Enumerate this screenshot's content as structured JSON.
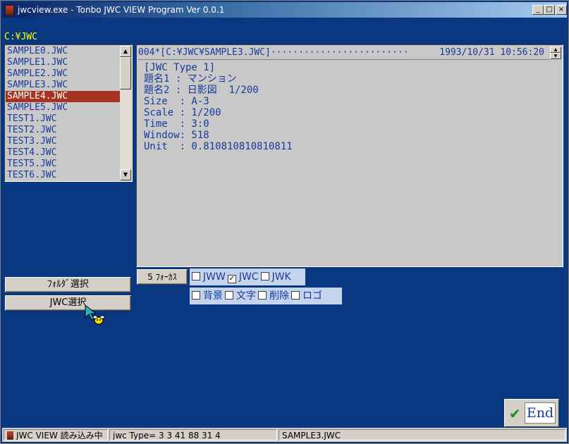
{
  "window": {
    "title": "jwcview.exe - Tonbo JWC VIEW Program Ver 0.0.1",
    "minimize": "_",
    "maximize": "□",
    "close": "×"
  },
  "path": "C:¥JWC",
  "file_list": {
    "items": [
      "SAMPLE0.JWC",
      "SAMPLE1.JWC",
      "SAMPLE2.JWC",
      "SAMPLE3.JWC",
      "SAMPLE4.JWC",
      "SAMPLE5.JWC",
      "TEST1.JWC",
      "TEST2.JWC",
      "TEST3.JWC",
      "TEST4.JWC",
      "TEST5.JWC",
      "TEST6.JWC"
    ],
    "selected_index": 4
  },
  "viewer": {
    "header": "004*[C:¥JWC¥SAMPLE3.JWC]·························",
    "date": "1993/10/31 10:56:20",
    "lines": [
      "[JWC Type 1]",
      "題名1 : マンション",
      "題名2 : 日影図  1/200",
      "Size  : A-3",
      "Scale : 1/200",
      "Time  : 3:0",
      "Window: 518",
      "Unit  : 0.810810810810811"
    ]
  },
  "buttons": {
    "folder_select": "ﾌｫﾙﾀﾞ選択",
    "jwc_select": "JWC選択",
    "focus": "5 ﾌｫｰｶｽ",
    "end": "End"
  },
  "filetypes": [
    {
      "label": "JWW",
      "checked": false
    },
    {
      "label": "JWC",
      "checked": true
    },
    {
      "label": "JWK",
      "checked": false
    }
  ],
  "options": [
    {
      "label": "背景",
      "checked": false
    },
    {
      "label": "文字",
      "checked": false
    },
    {
      "label": "削除",
      "checked": false
    },
    {
      "label": "ロゴ",
      "checked": false
    }
  ],
  "status": {
    "reading": "JWC VIEW 読み込み中",
    "type_info": "jwc Type= 3 3 41 88 31 4",
    "file": "SAMPLE3.JWC"
  },
  "colors": {
    "background": "#0a3880",
    "selection": "#a83222",
    "text": "#1a3a9a",
    "path": "#ffff00"
  }
}
